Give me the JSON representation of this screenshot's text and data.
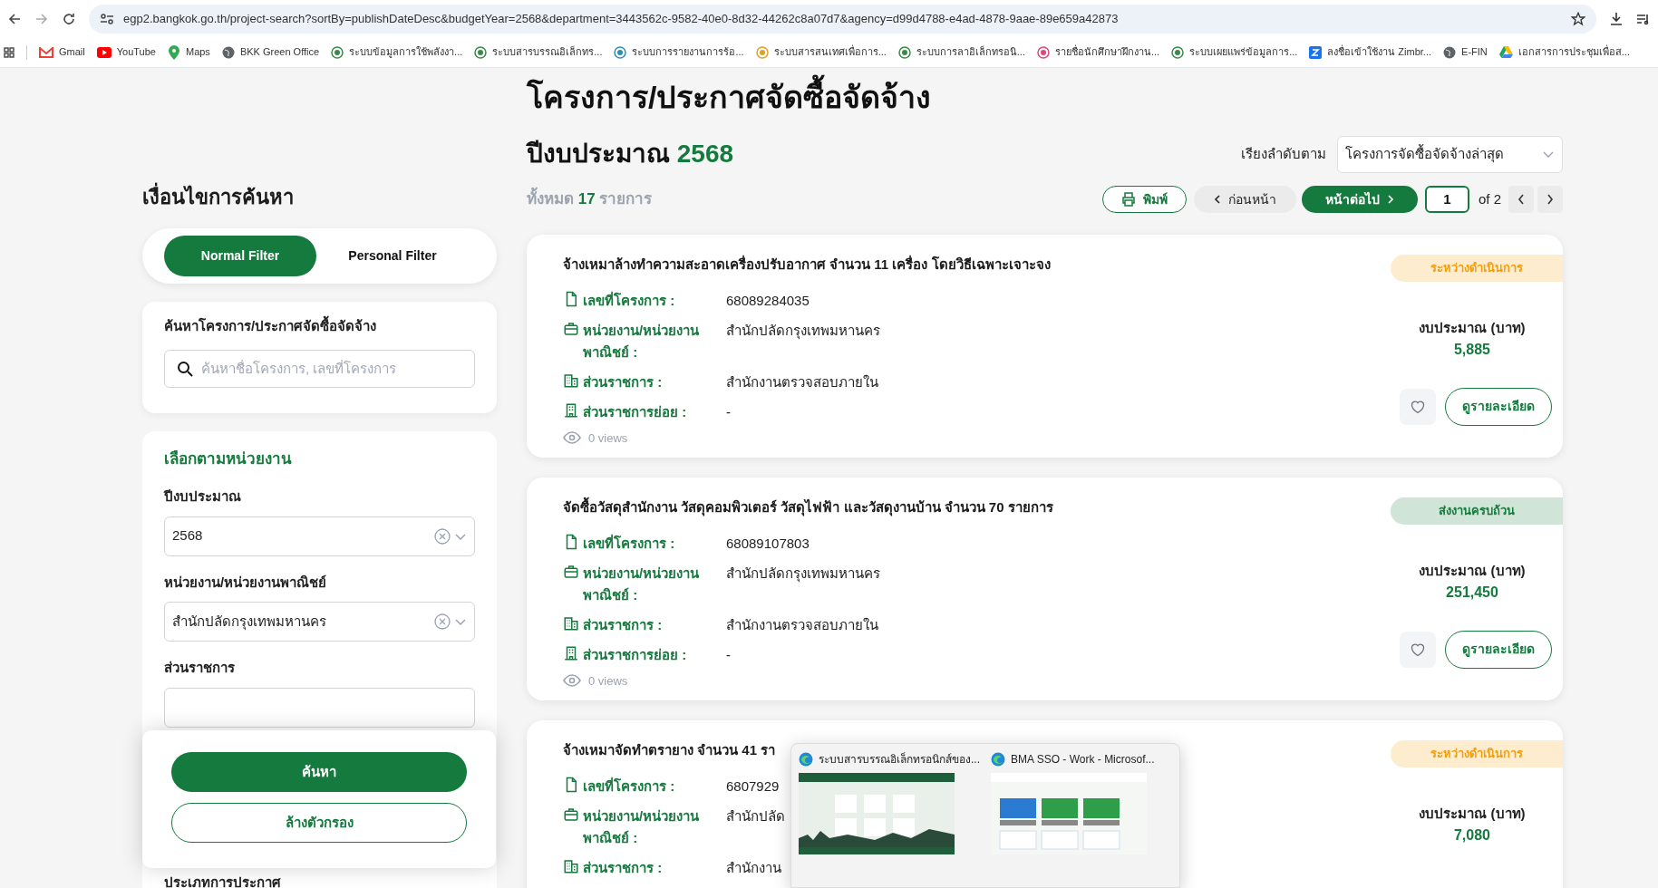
{
  "browser": {
    "url": "egp2.bangkok.go.th/project-search?sortBy=publishDateDesc&budgetYear=2568&department=3443562c-9582-40e0-8d32-44262c8a07d7&agency=d99d4788-e4ad-4878-9aae-89e659a42873",
    "bookmarks": [
      "Gmail",
      "YouTube",
      "Maps",
      "BKK Green Office",
      "ระบบข้อมูลการใช้พลังงา...",
      "ระบบสารบรรณอิเล็กทร...",
      "ระบบการรายงานการร้อ...",
      "ระบบสารสนเทศเพื่อการ...",
      "ระบบการลาอิเล็กทรอนิ...",
      "รายชื่อนักศึกษาฝึกงาน...",
      "ระบบเผยแพร่ข้อมูลการ...",
      "ลงชื่อเข้าใช้งาน Zimbr...",
      "E-FIN",
      "เอกสารการประชุมเพื่อส..."
    ]
  },
  "page": {
    "title": "โครงการ/ประกาศจัดซื้อจัดจ้าง",
    "year_label": "ปีงบประมาณ",
    "year": "2568",
    "sort_label": "เรียงลำดับตาม",
    "sort_value": "โครงการจัดซื้อจัดจ้างล่าสุด",
    "total_prefix": "ทั้งหมด",
    "total_count": "17",
    "total_suffix": "รายการ",
    "print": "พิมพ์",
    "prev": "ก่อนหน้า",
    "next": "หน้าต่อไป",
    "page_number": "1",
    "page_of": "of 2"
  },
  "sidebar": {
    "heading": "เงื่อนไขการค้นหา",
    "filter_tabs": [
      {
        "label": "Normal Filter",
        "selected": true
      },
      {
        "label": "Personal Filter",
        "selected": false
      }
    ],
    "search": {
      "label": "ค้นหาโครงการ/ประกาศจัดซื้อจัดจ้าง",
      "placeholder": "ค้นหาชื่อโครงการ, เลขที่โครงการ"
    },
    "unit_filter": {
      "heading": "เลือกตามหน่วยงาน",
      "fields": [
        {
          "label": "ปีงบประมาณ",
          "value": "2568"
        },
        {
          "label": "หน่วยงาน/หน่วยงานพาณิชย์",
          "value": "สำนักปลัดกรุงเทพมหานคร"
        },
        {
          "label": "ส่วนราชการ"
        }
      ],
      "next_label": "ประเภทการประกาศ"
    },
    "search_button": "ค้นหา",
    "clear_button": "ล้างตัวกรอง"
  },
  "cards": [
    {
      "title": "จ้างเหมาล้างทำความสะอาดเครื่องปรับอากาศ จำนวน 11 เครื่อง โดยวิธีเฉพาะเจาะจง",
      "status": "ระหว่างดำเนินการ",
      "color": "#f59e0b",
      "fields": [
        {
          "kind": "number",
          "label": "เลขที่โครงการ :",
          "value": "68089284035"
        },
        {
          "kind": "agency",
          "label": "หน่วยงาน/หน่วยงาน\nพาณิชย์ :",
          "value": "สำนักปลัดกรุงเทพมหานคร"
        },
        {
          "kind": "division",
          "label": "ส่วนราชการ :",
          "value": "สำนักงานตรวจสอบภายใน"
        },
        {
          "kind": "subdivision",
          "label": "ส่วนราชการย่อย :",
          "value": "-"
        }
      ],
      "views": "0 views",
      "budget_label": "งบประมาณ (บาท)",
      "budget": "5,885",
      "details": "ดูรายละเอียด"
    },
    {
      "title": "จัดซื้อวัสดุสำนักงาน วัสดุคอมพิวเตอร์ วัสดุไฟฟ้า และวัสดุงานบ้าน จำนวน 70 รายการ",
      "status": "ส่งงานครบถ้วน",
      "color": "#157a3e",
      "fields": [
        {
          "kind": "number",
          "label": "เลขที่โครงการ :",
          "value": "68089107803"
        },
        {
          "kind": "agency",
          "label": "หน่วยงาน/หน่วยงาน\nพาณิชย์ :",
          "value": "สำนักปลัดกรุงเทพมหานคร"
        },
        {
          "kind": "division",
          "label": "ส่วนราชการ :",
          "value": "สำนักงานตรวจสอบภายใน"
        },
        {
          "kind": "subdivision",
          "label": "ส่วนราชการย่อย :",
          "value": "-"
        }
      ],
      "views": "0 views",
      "budget_label": "งบประมาณ (บาท)",
      "budget": "251,450",
      "details": "ดูรายละเอียด"
    },
    {
      "title": "จ้างเหมาจัดทำตรายาง จำนวน 41 รา",
      "status": "ระหว่างดำเนินการ",
      "color": "#f59e0b",
      "fields": [
        {
          "kind": "number",
          "label": "เลขที่โครงการ :",
          "value": "6807929"
        },
        {
          "kind": "agency",
          "label": "หน่วยงาน/หน่วยงาน\nพาณิชย์ :",
          "value": "สำนักปลัด"
        },
        {
          "kind": "division",
          "label": "ส่วนราชการ :",
          "value": "สำนักงาน"
        }
      ],
      "budget_label": "งบประมาณ (บาท)",
      "budget": "7,080"
    }
  ],
  "taskbar_preview": [
    {
      "title": "ระบบสารบรรณอิเล็กทรอนิกส์ของ..."
    },
    {
      "title": "BMA SSO - Work - Microsof..."
    }
  ]
}
